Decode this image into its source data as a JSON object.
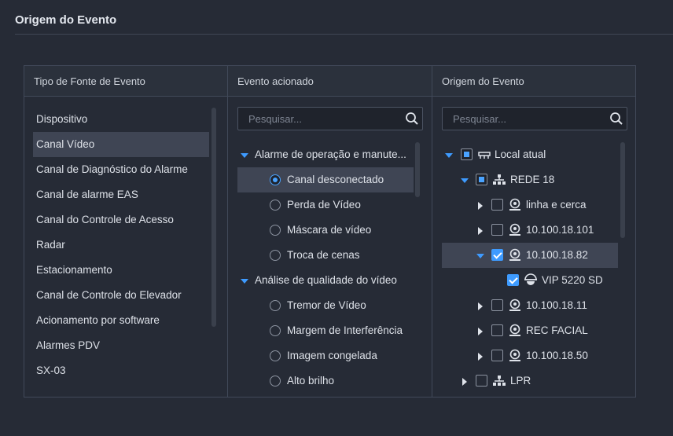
{
  "page": {
    "title": "Origem do Evento"
  },
  "source_type": {
    "header": "Tipo de Fonte de Evento",
    "items": [
      "Dispositivo",
      "Canal Vídeo",
      "Canal de Diagnóstico do Alarme",
      "Canal de alarme EAS",
      "Canal do Controle de Acesso",
      "Radar",
      "Estacionamento",
      "Canal de Controle do Elevador",
      "Acionamento por software",
      "Alarmes PDV",
      "SX-03"
    ],
    "selected_index": 1
  },
  "triggered_event": {
    "header": "Evento acionado",
    "search_placeholder": "Pesquisar...",
    "groups": [
      {
        "label": "Alarme de operação e manute...",
        "items": [
          "Canal desconectado",
          "Perda de Vídeo",
          "Máscara de vídeo",
          "Troca de cenas"
        ]
      },
      {
        "label": "Análise de qualidade do vídeo",
        "items": [
          "Tremor de Vídeo",
          "Margem de Interferência",
          "Imagem congelada",
          "Alto brilho"
        ]
      }
    ],
    "selected": "Canal desconectado"
  },
  "event_origin": {
    "header": "Origem do Evento",
    "search_placeholder": "Pesquisar...",
    "tree": {
      "root": "Local atual",
      "org": "REDE 18",
      "devices": [
        "linha e cerca",
        "10.100.18.101",
        "10.100.18.82",
        "10.100.18.11",
        "REC FACIAL",
        "10.100.18.50"
      ],
      "channel": "VIP 5220 SD",
      "org2": "LPR"
    }
  },
  "colors": {
    "background": "#262b36",
    "accent": "#3e9bff",
    "selected_row": "#3f4554",
    "border": "#414959"
  },
  "icons": {
    "search": "search-icon",
    "caret_down": "caret-down-icon",
    "caret_right": "caret-right-icon",
    "root": "local-server-icon",
    "org": "network-org-icon",
    "device": "camera-device-icon",
    "channel": "dome-camera-icon"
  }
}
